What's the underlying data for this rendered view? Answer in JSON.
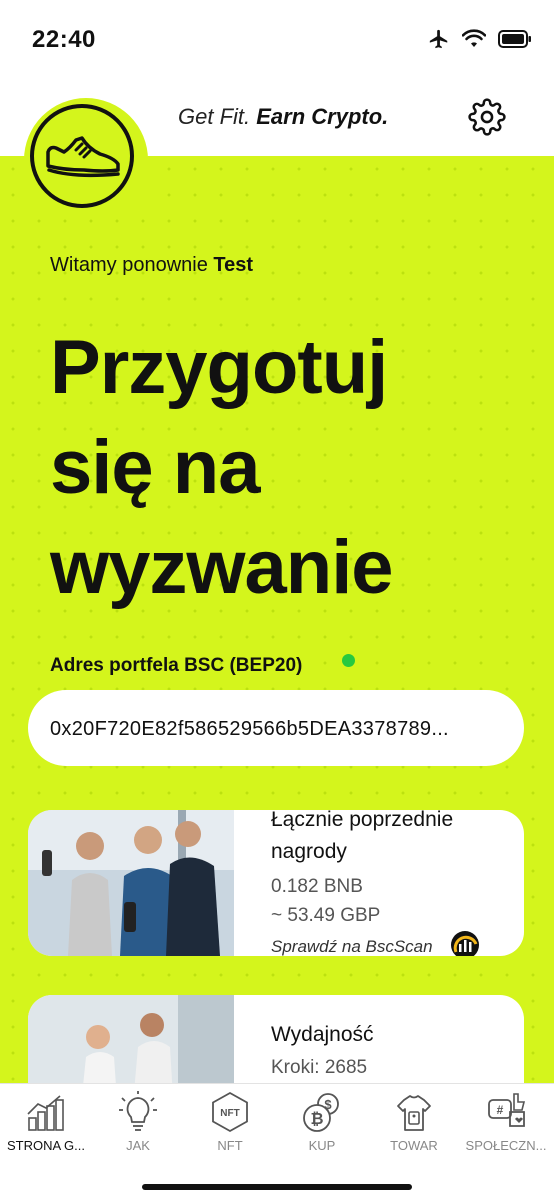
{
  "status_bar": {
    "time": "22:40"
  },
  "header": {
    "tagline_light": "Get Fit. ",
    "tagline_bold": "Earn Crypto."
  },
  "hero": {
    "welcome_prefix": "Witamy ponownie ",
    "welcome_name": "Test",
    "headline": [
      "Przygotuj",
      "się na",
      "wyzwanie"
    ]
  },
  "wallet": {
    "label": "Adres portfela BSC (BEP20)",
    "status_color": "#27c93f",
    "address": "0x20F720E82f586529566b5DEA3378789..."
  },
  "rewards_card": {
    "title_line1": "Łącznie poprzednie",
    "title_line2": "nagrody",
    "amount_bnb": "0.182 BNB",
    "amount_gbp": "~ 53.49 GBP",
    "link": "Sprawdź na BscScan"
  },
  "performance_card": {
    "title": "Wydajność",
    "steps": "Kroki: 2685"
  },
  "bottom_nav": [
    {
      "label": "STRONA G...",
      "icon": "home-chart-icon",
      "active": true
    },
    {
      "label": "JAK",
      "icon": "lightbulb-icon",
      "active": false
    },
    {
      "label": "NFT",
      "icon": "nft-icon",
      "active": false
    },
    {
      "label": "KUP",
      "icon": "coins-icon",
      "active": false
    },
    {
      "label": "TOWAR",
      "icon": "tshirt-tag-icon",
      "active": false
    },
    {
      "label": "SPOŁECZN...",
      "icon": "social-icon",
      "active": false
    }
  ],
  "colors": {
    "accent": "#d4f51c",
    "text": "#111111"
  }
}
